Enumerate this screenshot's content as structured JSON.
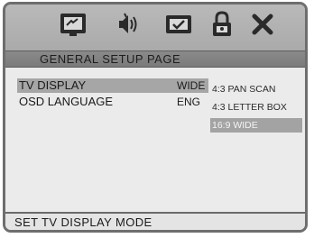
{
  "toolbar": {
    "icons": [
      {
        "name": "general-setup-icon"
      },
      {
        "name": "audio-setup-icon"
      },
      {
        "name": "video-setup-icon"
      },
      {
        "name": "lock-icon"
      },
      {
        "name": "exit-icon"
      }
    ]
  },
  "page_title": "GENERAL SETUP PAGE",
  "menu": {
    "items": [
      {
        "label": "TV DISPLAY",
        "value": "WIDE"
      },
      {
        "label": "OSD LANGUAGE",
        "value": "ENG"
      }
    ]
  },
  "options": {
    "items": [
      {
        "label": "4:3 PAN SCAN"
      },
      {
        "label": "4:3 LETTER BOX"
      },
      {
        "label": "16:9 WIDE"
      }
    ]
  },
  "status": {
    "text": "SET TV DISPLAY MODE"
  },
  "colors": {
    "frame": "#6e6e6e",
    "toolbar": "#b3b3b3",
    "title_bar": "#838383",
    "selection": "#a6a6a6"
  }
}
